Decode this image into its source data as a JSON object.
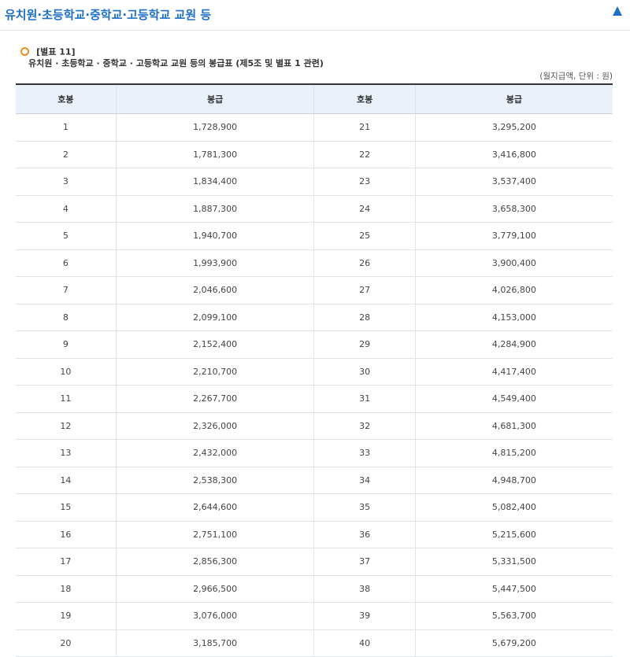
{
  "header": {
    "title": "유치원·초등학교·중학교·고등학교 교원 등",
    "toggle_icon": "triangle-up-icon"
  },
  "caption": {
    "label": "[별표 11]",
    "title": "유치원 · 초등학교 · 중학교 · 고등학교 교원 등의 봉급표 (제5조 및 별표 1 관련)",
    "unit_note": "(월지급액, 단위 : 원)"
  },
  "colors": {
    "accent": "#1d6fc7",
    "bullet": "#f08b1d",
    "table_header_bg": "#eaf1fb"
  },
  "table": {
    "headers": [
      "호봉",
      "봉급",
      "호봉",
      "봉급"
    ],
    "rows": [
      [
        "1",
        "1,728,900",
        "21",
        "3,295,200"
      ],
      [
        "2",
        "1,781,300",
        "22",
        "3,416,800"
      ],
      [
        "3",
        "1,834,400",
        "23",
        "3,537,400"
      ],
      [
        "4",
        "1,887,300",
        "24",
        "3,658,300"
      ],
      [
        "5",
        "1,940,700",
        "25",
        "3,779,100"
      ],
      [
        "6",
        "1,993,900",
        "26",
        "3,900,400"
      ],
      [
        "7",
        "2,046,600",
        "27",
        "4,026,800"
      ],
      [
        "8",
        "2,099,100",
        "28",
        "4,153,000"
      ],
      [
        "9",
        "2,152,400",
        "29",
        "4,284,900"
      ],
      [
        "10",
        "2,210,700",
        "30",
        "4,417,400"
      ],
      [
        "11",
        "2,267,700",
        "31",
        "4,549,400"
      ],
      [
        "12",
        "2,326,000",
        "32",
        "4,681,300"
      ],
      [
        "13",
        "2,432,000",
        "33",
        "4,815,200"
      ],
      [
        "14",
        "2,538,300",
        "34",
        "4,948,700"
      ],
      [
        "15",
        "2,644,600",
        "35",
        "5,082,400"
      ],
      [
        "16",
        "2,751,100",
        "36",
        "5,215,600"
      ],
      [
        "17",
        "2,856,300",
        "37",
        "5,331,500"
      ],
      [
        "18",
        "2,966,500",
        "38",
        "5,447,500"
      ],
      [
        "19",
        "3,076,000",
        "39",
        "5,563,700"
      ],
      [
        "20",
        "3,185,700",
        "40",
        "5,679,200"
      ]
    ]
  }
}
